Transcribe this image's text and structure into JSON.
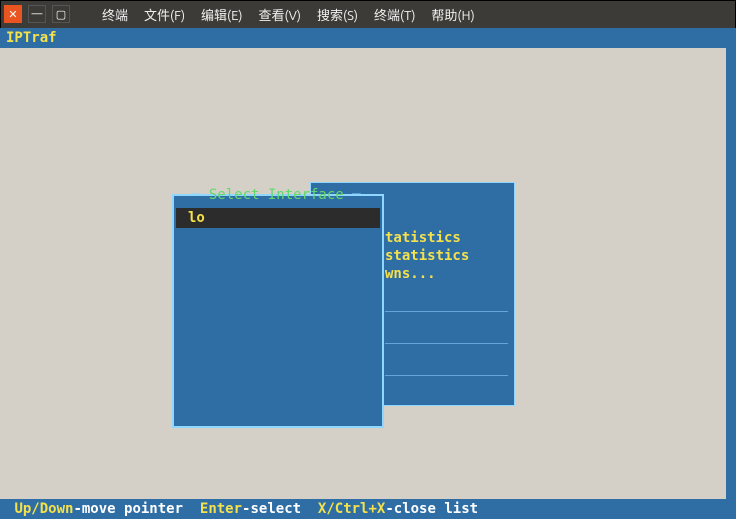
{
  "window": {
    "menu": {
      "terminal_word": "终端",
      "file": "文件(F)",
      "edit": "编辑(E)",
      "view": "查看(V)",
      "search": "搜索(S)",
      "terminal": "终端(T)",
      "help": "帮助(H)"
    }
  },
  "app": {
    "title": "IPTraf"
  },
  "back_panel": {
    "line1": "tatistics",
    "line2": "statistics",
    "line3": "wns..."
  },
  "front_panel": {
    "title": "Select Interface",
    "items": [
      {
        "label": "lo",
        "selected": true
      }
    ]
  },
  "status": {
    "k1": "Up/Down",
    "t1": "-move pointer  ",
    "k2": "Enter",
    "t2": "-select  ",
    "k3": "X/Ctrl+X",
    "t3": "-close list"
  }
}
